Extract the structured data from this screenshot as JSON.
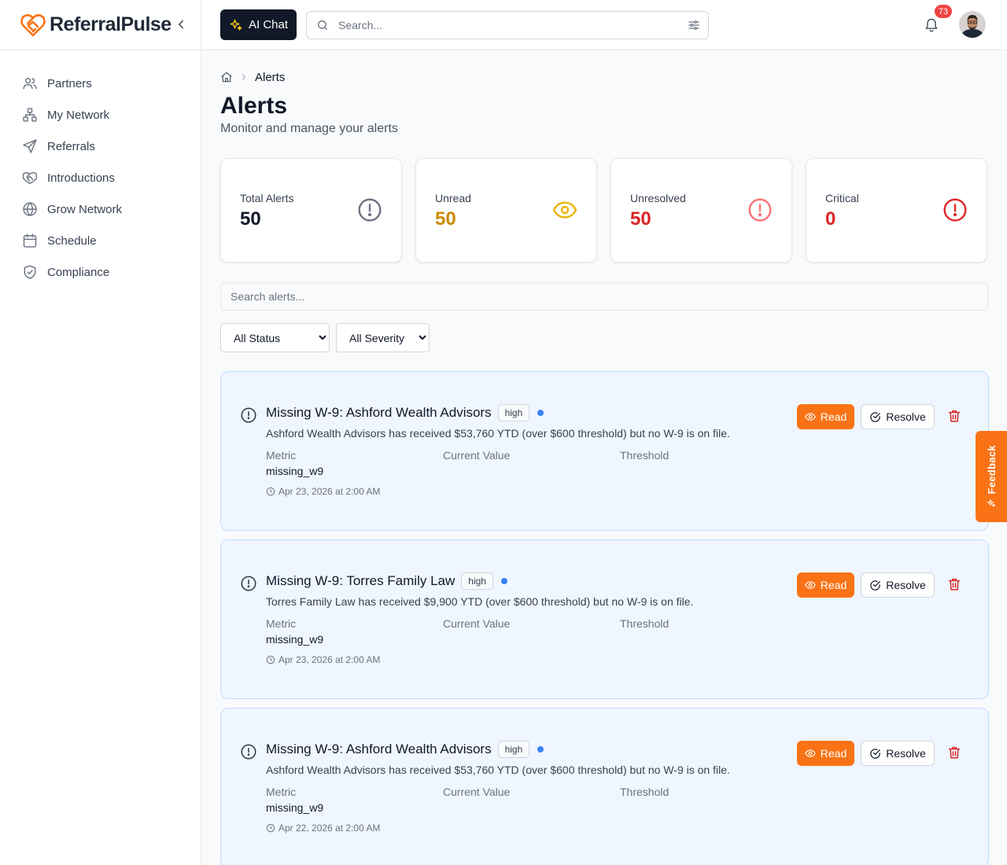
{
  "brand": {
    "name": "ReferralPulse",
    "logo_icon": "heart-handshake-logo",
    "accent": "#f97316"
  },
  "sidebar": {
    "items": [
      {
        "label": "Partners",
        "icon": "users-icon"
      },
      {
        "label": "My Network",
        "icon": "network-icon"
      },
      {
        "label": "Referrals",
        "icon": "send-icon"
      },
      {
        "label": "Introductions",
        "icon": "handshake-icon"
      },
      {
        "label": "Grow Network",
        "icon": "globe-icon"
      },
      {
        "label": "Schedule",
        "icon": "calendar-icon"
      },
      {
        "label": "Compliance",
        "icon": "shield-check-icon"
      }
    ]
  },
  "topbar": {
    "ai_chat_label": "AI Chat",
    "search_placeholder": "Search...",
    "notification_count": "73"
  },
  "breadcrumb": {
    "current": "Alerts"
  },
  "page": {
    "title": "Alerts",
    "subtitle": "Monitor and manage your alerts"
  },
  "stats": [
    {
      "label": "Total Alerts",
      "value": "50",
      "color": "#111827",
      "icon_color": "#6b7280"
    },
    {
      "label": "Unread",
      "value": "50",
      "color": "#ca8a04",
      "icon_color": "#eab308"
    },
    {
      "label": "Unresolved",
      "value": "50",
      "color": "#dc2626",
      "icon_color": "#f87171"
    },
    {
      "label": "Critical",
      "value": "0",
      "color": "#dc2626",
      "icon_color": "#dc2626"
    }
  ],
  "alert_search_placeholder": "Search alerts...",
  "filters": {
    "status": {
      "selected": "All Status"
    },
    "severity": {
      "selected": "All Severity"
    }
  },
  "alert_labels": {
    "metric": "Metric",
    "current_value": "Current Value",
    "threshold": "Threshold",
    "read": "Read",
    "resolve": "Resolve"
  },
  "alerts": [
    {
      "title": "Missing W-9: Ashford Wealth Advisors",
      "severity": "high",
      "description": "Ashford Wealth Advisors has received $53,760 YTD (over $600 threshold) but no W-9 is on file.",
      "metric": "missing_w9",
      "timestamp": "Apr 23, 2026 at 2:00 AM"
    },
    {
      "title": "Missing W-9: Torres Family Law",
      "severity": "high",
      "description": "Torres Family Law has received $9,900 YTD (over $600 threshold) but no W-9 is on file.",
      "metric": "missing_w9",
      "timestamp": "Apr 23, 2026 at 2:00 AM"
    },
    {
      "title": "Missing W-9: Ashford Wealth Advisors",
      "severity": "high",
      "description": "Ashford Wealth Advisors has received $53,760 YTD (over $600 threshold) but no W-9 is on file.",
      "metric": "missing_w9",
      "timestamp": "Apr 22, 2026 at 2:00 AM"
    }
  ],
  "feedback_label": "Feedback"
}
